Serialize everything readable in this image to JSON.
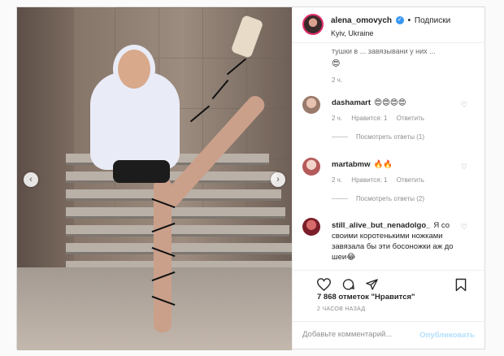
{
  "post": {
    "username": "alena_omovych",
    "verified_mark": "✓",
    "separator": "•",
    "follow_label": "Подписки",
    "location": "Kyiv, Ukraine",
    "more_icon": "more-horizontal-icon"
  },
  "partial_comment": {
    "text": "тушки в ... завязывани у них ...",
    "emoji": "😍",
    "time": "2 ч."
  },
  "comments": [
    {
      "username": "dashamart",
      "text": "😍😍😍😍",
      "time": "2 ч.",
      "likes": "Нравится: 1",
      "reply": "Ответить",
      "replies": "Посмотреть ответы (1)"
    },
    {
      "username": "martabmw",
      "text": "🔥🔥",
      "time": "2 ч.",
      "likes": "Нравится: 1",
      "reply": "Ответить",
      "replies": "Посмотреть ответы (2)"
    },
    {
      "username": "still_alive_but_nenadolgo_",
      "text": "Я со своими коротенькими ножками завязала бы эти босоножки аж до шеи😂"
    }
  ],
  "actions": {
    "like_icon": "heart-icon",
    "comment_icon": "comment-icon",
    "share_icon": "share-icon",
    "save_icon": "bookmark-icon"
  },
  "likes_text": "7 868 отметок \"Нравится\"",
  "time_ago": "2 ЧАСОВ НАЗАД",
  "add_comment": {
    "placeholder": "Добавьте комментарий...",
    "publish_label": "Опубликовать"
  },
  "colors": {
    "accent": "#3897f0",
    "publish_disabled": "#b2dffc",
    "muted": "#8e8e8e"
  }
}
